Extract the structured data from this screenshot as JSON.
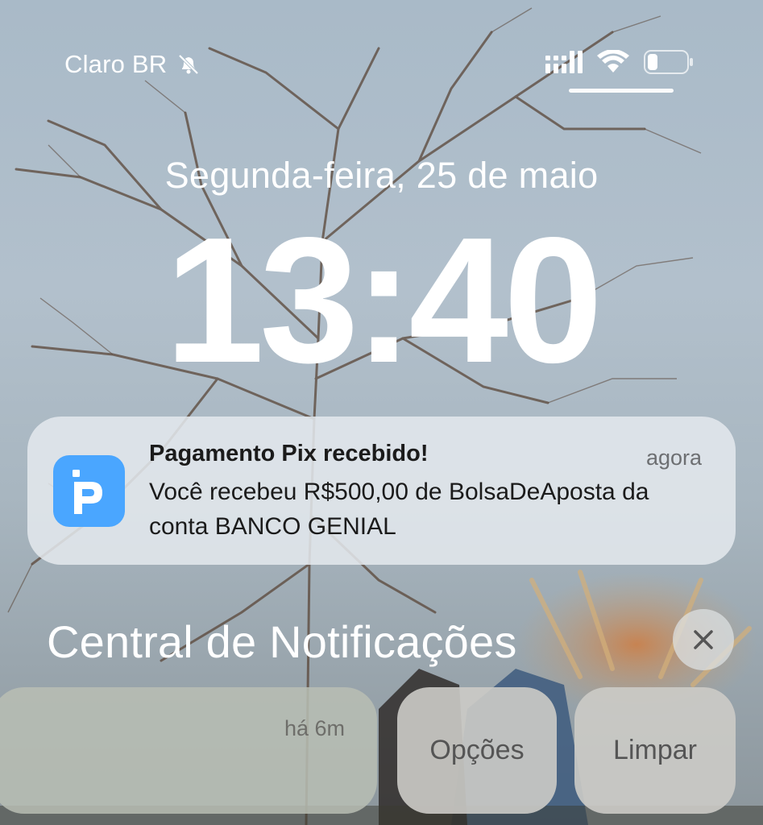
{
  "status_bar": {
    "carrier": "Claro BR",
    "mute_icon": "bell-slash-icon",
    "signal_icon": "cellular-signal-icon",
    "wifi_icon": "wifi-icon",
    "battery_icon": "battery-low-icon"
  },
  "lock_screen": {
    "date": "Segunda-feira, 25 de maio",
    "time": "13:40"
  },
  "notification": {
    "app_icon": "pix-p-icon",
    "title": "Pagamento Pix recebido!",
    "time": "agora",
    "body": "Você recebeu R$500,00 de BolsaDeAposta da conta BANCO GENIAL"
  },
  "notification_center": {
    "title": "Central de Notificações",
    "close_icon": "close-icon",
    "card_time": "há 6m",
    "options_label": "Opções",
    "clear_label": "Limpar"
  },
  "colors": {
    "sky": "#a9bac8",
    "app_icon_blue": "#4aa6ff"
  }
}
